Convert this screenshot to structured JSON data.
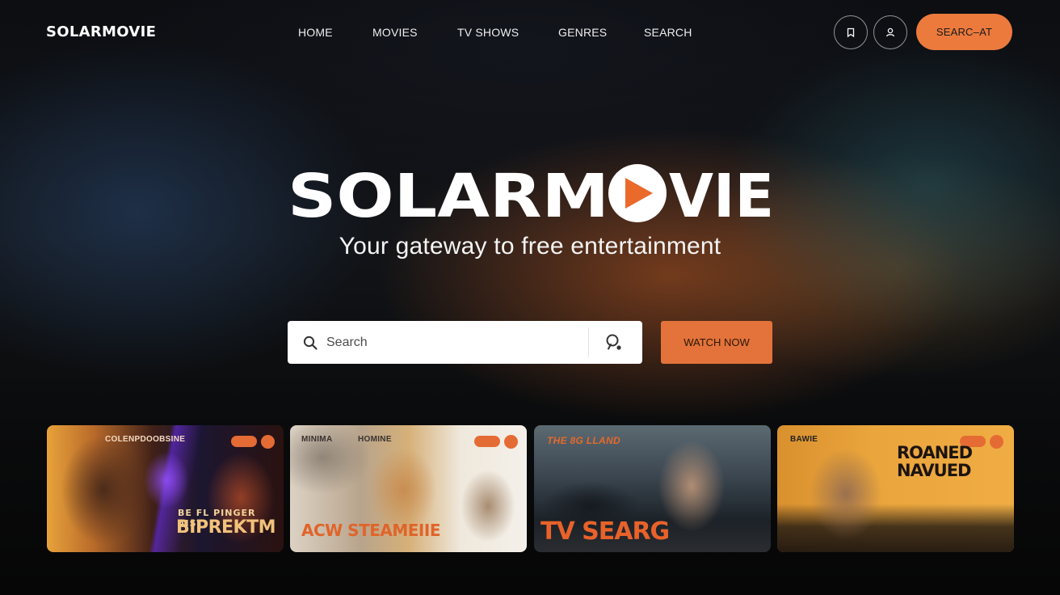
{
  "nav": {
    "logo": "SOLARMOVIE",
    "links": [
      "HOME",
      "MOVIES",
      "TV SHOWS",
      "GENRES",
      "SEARCH"
    ],
    "cta_label": "SEARC–AT",
    "icon_buttons": [
      "bookmark-icon",
      "user-icon"
    ]
  },
  "hero": {
    "logo_left": "SOLARM",
    "logo_right": "VIE",
    "tagline": "Your gateway to free entertainment"
  },
  "search": {
    "placeholder": "Search",
    "value": "",
    "watch_label": "WATCH NOW"
  },
  "cards": [
    {
      "top_label": "COLENPDOOBSINE",
      "big_line1": "BE FL PINGER AIST",
      "big_line2": "BIPREKTM"
    },
    {
      "top_label": "MINIMA",
      "top_label2": "HOMINE",
      "big_line1": "ACW STEAMEIIE"
    },
    {
      "top_label": "THE 8G LLAND",
      "big_line1": "TV SEARG"
    },
    {
      "top_label": "BAWIE",
      "big_line1": "ROANED",
      "big_line2": "NAVUED"
    }
  ],
  "colors": {
    "accent": "#ec7a3d",
    "background": "#0a0b0d"
  }
}
